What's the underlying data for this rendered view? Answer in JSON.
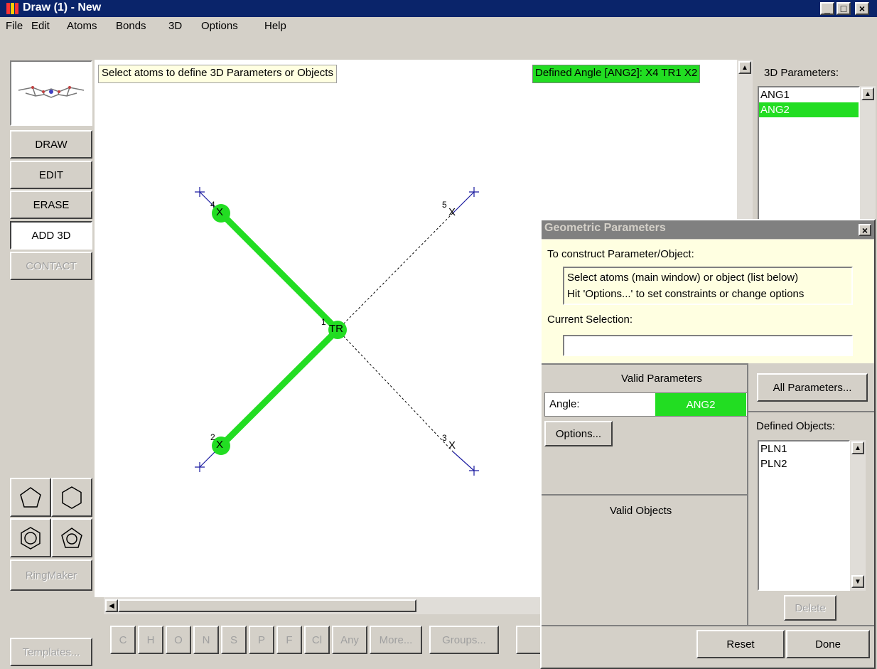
{
  "window": {
    "title": "Draw (1) - New",
    "minimize": "_",
    "maximize": "□",
    "close": "×"
  },
  "menu": [
    "File",
    "Edit",
    "Atoms",
    "Bonds",
    "3D",
    "Options",
    "Help"
  ],
  "modes": [
    "DRAW",
    "EDIT",
    "ERASE",
    "ADD 3D",
    "CONTACT"
  ],
  "ringmaker": "RingMaker",
  "templates": "Templates...",
  "canvas": {
    "hint": "Select atoms to define 3D Parameters or Objects",
    "defined": "Defined Angle [ANG2]: X4 TR1 X2",
    "atoms": [
      {
        "label": "X",
        "num": "4"
      },
      {
        "label": "TR",
        "num": "1"
      },
      {
        "label": "X",
        "num": "2"
      },
      {
        "label": "X",
        "num": "5"
      },
      {
        "label": "X",
        "num": "3"
      }
    ]
  },
  "elements": [
    "C",
    "H",
    "O",
    "N",
    "S",
    "P",
    "F",
    "Cl",
    "Any",
    "More...",
    "Groups..."
  ],
  "params3d": {
    "title": "3D Parameters:",
    "items": [
      "ANG1",
      "ANG2"
    ]
  },
  "dialog": {
    "title": "Geometric Parameters",
    "close": "×",
    "construct": "To construct Parameter/Object:",
    "help1": "Select atoms (main window) or object (list below)",
    "help2": "Hit 'Options...' to set constraints or change options",
    "current_label": "Current Selection:",
    "current_value": "",
    "valid_params": "Valid Parameters",
    "angle_label": "Angle:",
    "angle_value": "ANG2",
    "options": "Options...",
    "valid_objects": "Valid Objects",
    "all_params": "All Parameters...",
    "defined_objects": "Defined Objects:",
    "objects": [
      "PLN1",
      "PLN2"
    ],
    "delete": "Delete",
    "reset": "Reset",
    "done": "Done"
  },
  "colors": {
    "title_bar": "#0a246a",
    "highlight": "#22dd22",
    "atom_cross": "#1a1aa0",
    "hint_bg": "#ffffe1"
  }
}
